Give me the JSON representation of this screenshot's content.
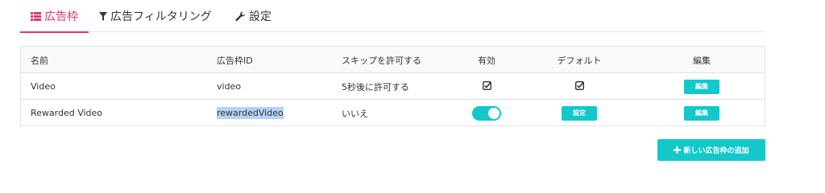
{
  "tabs": [
    {
      "label": "広告枠",
      "icon": "list-icon",
      "active": true
    },
    {
      "label": "広告フィルタリング",
      "icon": "filter-icon",
      "active": false
    },
    {
      "label": "設定",
      "icon": "wrench-icon",
      "active": false
    }
  ],
  "table": {
    "headers": [
      "名前",
      "広告枠ID",
      "スキップを許可する",
      "有効",
      "デフォルト",
      "編集"
    ],
    "rows": [
      {
        "name": "Video",
        "id": "video",
        "skip": "5秒後に許可する",
        "enabled": "checked",
        "default": "checked",
        "edit_label": "編集"
      },
      {
        "name": "Rewarded Video",
        "id": "rewardedVideo",
        "skip": "いいえ",
        "enabled": "toggle-on",
        "default_button": "設定",
        "edit_label": "編集"
      }
    ]
  },
  "add_button": {
    "label": "新しい広告枠の追加",
    "icon": "plus-icon"
  },
  "colors": {
    "accent": "#e5336f",
    "teal": "#14c7c9",
    "selection": "#b3d2f5"
  }
}
